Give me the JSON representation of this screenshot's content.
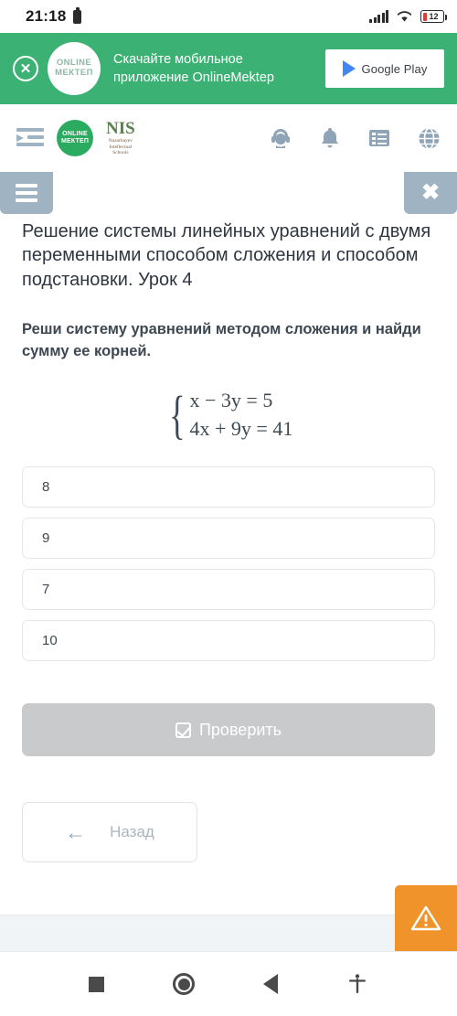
{
  "status_bar": {
    "time": "21:18",
    "device_icon": "battery-icon",
    "signal_icon": "cellular-signal-icon",
    "wifi_icon": "wifi-icon",
    "battery_level": "12"
  },
  "promo_banner": {
    "close_icon": "close-circle-icon",
    "logo_line1": "ONLINE",
    "logo_line2": "МЕКТЕП",
    "text_line1": "Скачайте мобильное",
    "text_line2": "приложение OnlineMektep",
    "store_button": "Google Play",
    "store_icon": "google-play-icon",
    "background_color": "#3bb273"
  },
  "site_nav": {
    "indent_icon": "sidebar-indent-icon",
    "brand_logo_line1": "ONLINE",
    "brand_logo_line2": "МЕКТЕП",
    "nis_title": "NIS",
    "nis_sub_line1": "Nazarbayev",
    "nis_sub_line2": "Intellectual",
    "nis_sub_line3": "Schools",
    "icons": [
      {
        "name": "support-headset-icon",
        "glyph": "🎧"
      },
      {
        "name": "bell-icon",
        "glyph": "🔔"
      },
      {
        "name": "list-icon",
        "glyph": "☰"
      },
      {
        "name": "globe-icon",
        "glyph": "🌐"
      }
    ]
  },
  "menu_strip": {
    "menu_icon": "hamburger-menu-icon",
    "close_icon": "close-icon",
    "tab_color": "#9fb3c3"
  },
  "lesson": {
    "title": "Решение системы линейных уравнений с двумя переменными способом сложения и способом подстановки. Урок 4",
    "question": "Реши систему уравнений методом сложения и найди сумму ее корней."
  },
  "equation_system": {
    "line1": "x − 3y = 5",
    "line2": "4x + 9y = 41",
    "eq1": {
      "lhs_var1": "x",
      "minus": "−",
      "coef2": "3",
      "var2": "y",
      "eq": "=",
      "rhs": "5"
    },
    "eq2": {
      "coef1": "4",
      "var1": "x",
      "plus": "+",
      "coef2": "9",
      "var2": "y",
      "eq": "=",
      "rhs": "41"
    }
  },
  "options": [
    {
      "label": "8"
    },
    {
      "label": "9"
    },
    {
      "label": "7"
    },
    {
      "label": "10"
    }
  ],
  "actions": {
    "check_label": "Проверить",
    "check_icon": "checkbox-checked-icon",
    "check_disabled_color": "#c8cacb",
    "back_label": "Назад",
    "back_icon": "arrow-left-icon",
    "report_icon": "warning-triangle-icon",
    "report_color": "#f0932b"
  },
  "android_nav": {
    "recents_icon": "square-recents-icon",
    "home_icon": "circle-home-icon",
    "back_icon": "triangle-back-icon",
    "accessibility_icon": "accessibility-icon"
  }
}
